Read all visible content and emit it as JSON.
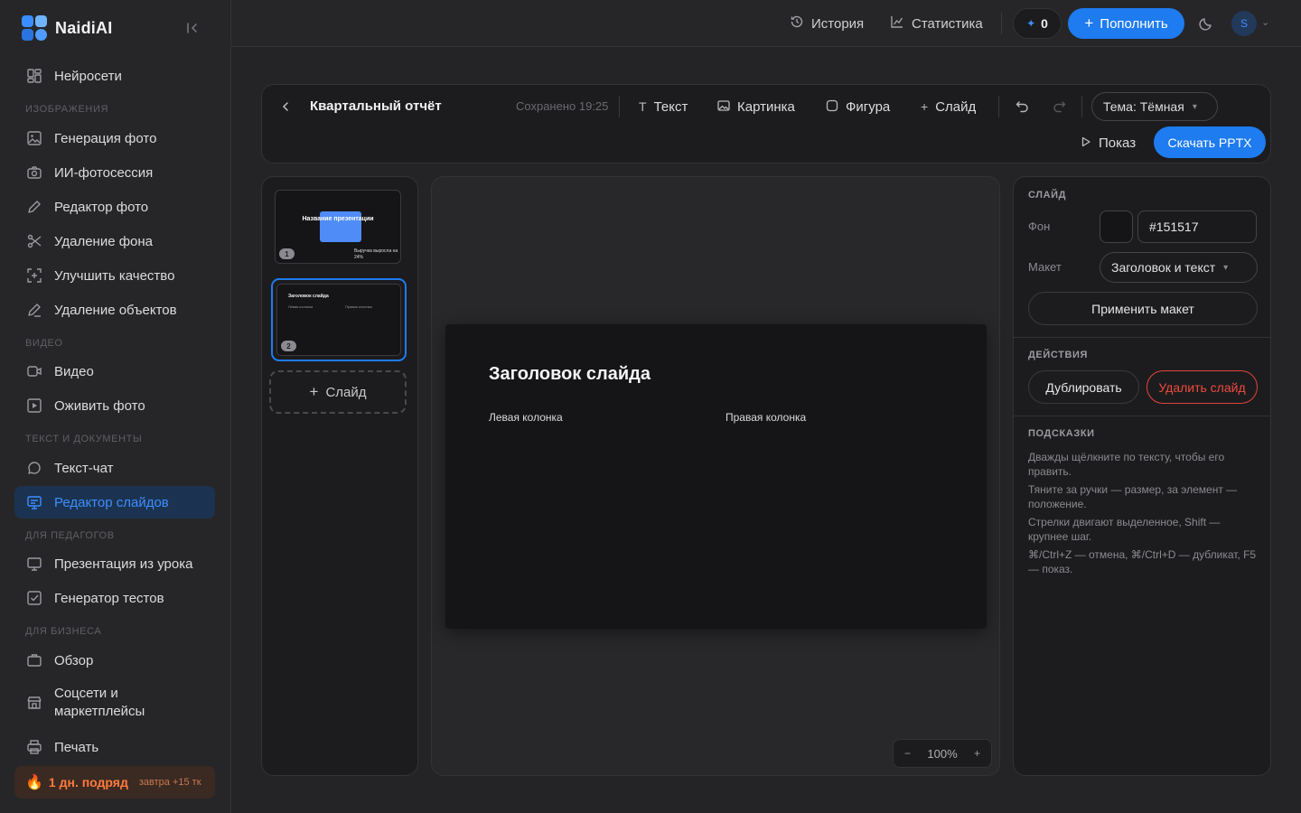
{
  "sidebar": {
    "brand": "NaidiAI",
    "top_item": "Нейросети",
    "sections": [
      {
        "title": "ИЗОБРАЖЕНИЯ",
        "items": [
          "Генерация фото",
          "ИИ-фотосессия",
          "Редактор фото",
          "Удаление фона",
          "Улучшить качество",
          "Удаление объектов"
        ]
      },
      {
        "title": "ВИДЕО",
        "items": [
          "Видео",
          "Оживить фото"
        ]
      },
      {
        "title": "ТЕКСТ И ДОКУМЕНТЫ",
        "items": [
          "Текст-чат",
          "Редактор слайдов"
        ]
      },
      {
        "title": "ДЛЯ ПЕДАГОГОВ",
        "items": [
          "Презентация из урока",
          "Генератор тестов"
        ]
      },
      {
        "title": "ДЛЯ БИЗНЕСА",
        "items": [
          "Обзор",
          "Соцсети и маркетплейсы",
          "Печать"
        ]
      }
    ],
    "active_item": "Редактор слайдов",
    "streak": {
      "days": "1 дн. подряд",
      "bonus": "завтра +15 тк"
    }
  },
  "topbar": {
    "history": "История",
    "stats": "Статистика",
    "credits": "0",
    "topup": "Пополнить",
    "avatar_initial": "S"
  },
  "editor": {
    "title": "Квартальный отчёт",
    "saved": "Сохранено 19:25",
    "tools": {
      "text": "Текст",
      "image": "Картинка",
      "shape": "Фигура",
      "slide": "Слайд"
    },
    "theme": "Тема: Тёмная",
    "show": "Показ",
    "download": "Скачать PPTX"
  },
  "slides": [
    {
      "number": "1",
      "title": "Название презентации",
      "stat": "Выручка выросла на 24%"
    },
    {
      "number": "2",
      "title": "Заголовок слайда",
      "left": "Левая колонка",
      "right": "Правая колонка"
    }
  ],
  "add_slide": "Слайд",
  "canvas": {
    "title": "Заголовок слайда",
    "left_column": "Левая колонка",
    "right_column": "Правая колонка",
    "zoom": "100%",
    "zoom_minus": "−",
    "zoom_plus": "+"
  },
  "properties": {
    "slide_header": "СЛАЙД",
    "bg_label": "Фон",
    "bg_value": "#151517",
    "layout_label": "Макет",
    "layout_value": "Заголовок и текст",
    "apply": "Применить макет",
    "actions_header": "ДЕЙСТВИЯ",
    "duplicate": "Дублировать",
    "delete": "Удалить слайд",
    "hints_header": "ПОДСКАЗКИ",
    "hints": [
      "Дважды щёлкните по тексту, чтобы его править.",
      "Тяните за ручки — размер, за элемент — положение.",
      "Стрелки двигают выделенное, Shift — крупнее шаг.",
      "⌘/Ctrl+Z — отмена, ⌘/Ctrl+D — дубликат, F5 — показ."
    ]
  },
  "colors": {
    "accent": "#1e7bf0",
    "danger": "#f04a3e",
    "slide_bg": "#151517"
  }
}
